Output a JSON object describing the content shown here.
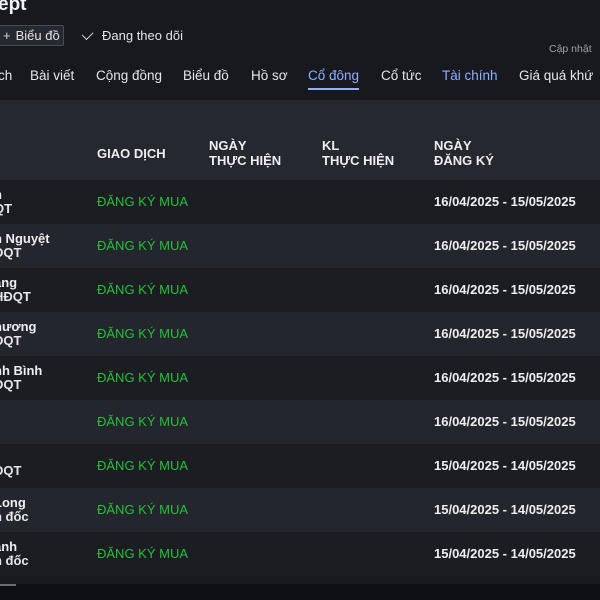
{
  "header": {
    "title": "ept",
    "chart_button": {
      "icon": "plus-icon",
      "label": "Biểu đồ"
    },
    "follow": {
      "icon": "check-icon",
      "label": "Đang theo dõi"
    },
    "update_label": "Cập nhật"
  },
  "tabs": [
    {
      "label": "ch",
      "state": "normal"
    },
    {
      "label": "Bài viết",
      "state": "normal"
    },
    {
      "label": "Cộng đồng",
      "state": "normal"
    },
    {
      "label": "Biểu đồ",
      "state": "normal"
    },
    {
      "label": "Hồ sơ",
      "state": "normal"
    },
    {
      "label": "Cổ đông",
      "state": "active"
    },
    {
      "label": "Cổ tức",
      "state": "normal"
    },
    {
      "label": "Tài chính",
      "state": "highlight"
    },
    {
      "label": "Giá quá khứ",
      "state": "normal"
    }
  ],
  "table": {
    "headers": {
      "transaction": "GIAO DỊCH",
      "exec_date_1": "NGÀY",
      "exec_date_2": "THỰC HIỆN",
      "exec_vol_1": "KL",
      "exec_vol_2": "THỰC HIỆN",
      "reg_date_1": "NGÀY",
      "reg_date_2": "ĐĂNG KÝ"
    },
    "rows": [
      {
        "name": "n",
        "role": "QT",
        "transaction": "ĐĂNG KÝ MUA",
        "reg_date": "16/04/2025 - 15/05/2025"
      },
      {
        "name": "n Nguyệt",
        "role": "ĐQT",
        "transaction": "ĐĂNG KÝ MUA",
        "reg_date": "16/04/2025 - 15/05/2025"
      },
      {
        "name": "ang",
        "role": "HĐQT",
        "transaction": "ĐĂNG KÝ MUA",
        "reg_date": "16/04/2025 - 15/05/2025"
      },
      {
        "name": "hương",
        "role": "ĐQT",
        "transaction": "ĐĂNG KÝ MUA",
        "reg_date": "16/04/2025 - 15/05/2025"
      },
      {
        "name": "nh Bình",
        "role": "ĐQT",
        "transaction": "ĐĂNG KÝ MUA",
        "reg_date": "16/04/2025 - 15/05/2025"
      },
      {
        "name": "",
        "role": "",
        "transaction": "ĐĂNG KÝ MUA",
        "reg_date": "16/04/2025 - 15/05/2025"
      },
      {
        "name": "",
        "role": "ĐQT",
        "transaction": "ĐĂNG KÝ MUA",
        "reg_date": "15/04/2025 - 14/05/2025"
      },
      {
        "name": "Long",
        "role": "n đốc",
        "transaction": "ĐĂNG KÝ MUA",
        "reg_date": "15/04/2025 - 14/05/2025"
      },
      {
        "name": "anh",
        "role": "n đốc",
        "transaction": "ĐĂNG KÝ MUA",
        "reg_date": "15/04/2025 - 14/05/2025"
      }
    ]
  },
  "colors": {
    "background": "#17191e",
    "accent": "#8fb0ff",
    "buy": "#25c13a"
  }
}
